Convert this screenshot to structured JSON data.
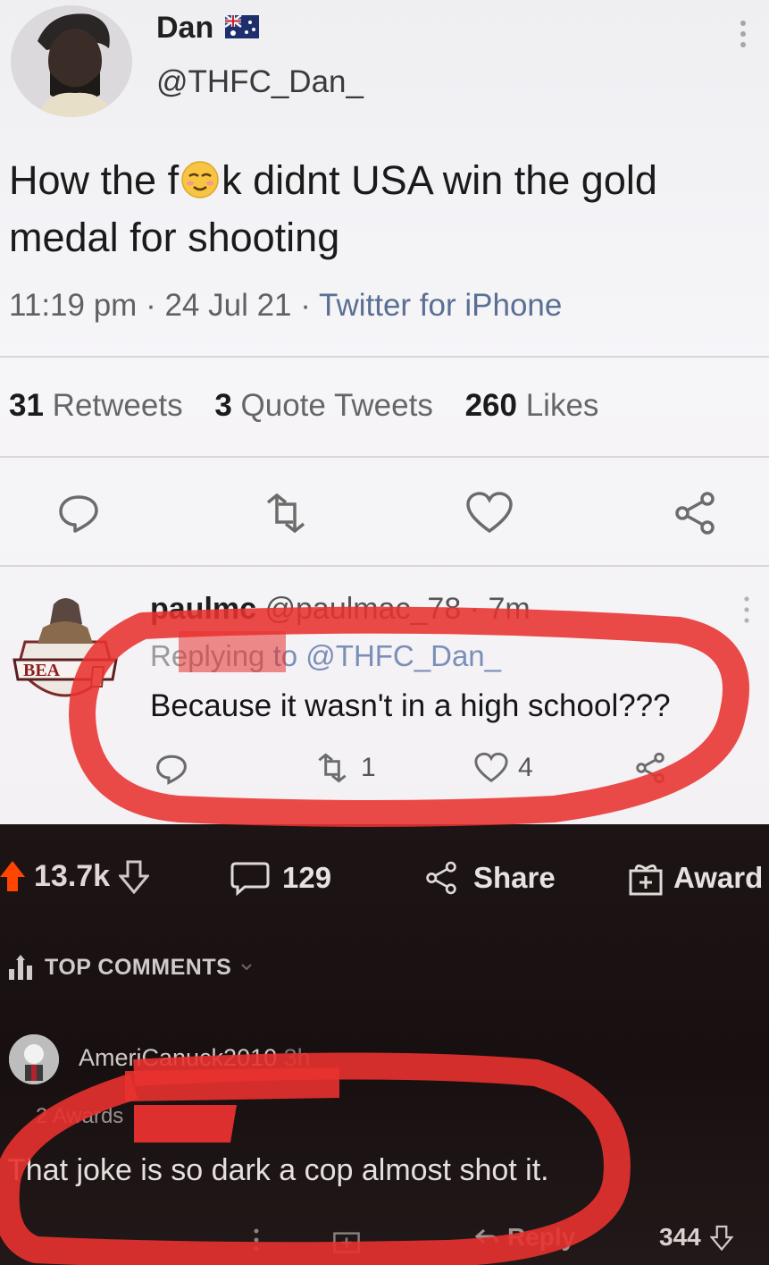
{
  "tweet": {
    "author_name": "Dan",
    "author_handle": "@THFC_Dan_",
    "text_before": "How the f",
    "text_after": "k didnt USA win the gold medal for shooting",
    "time": "11:19 pm",
    "date": "24 Jul 21",
    "source": "Twitter for iPhone",
    "retweets_count": "31",
    "retweets_label": "Retweets",
    "quotes_count": "3",
    "quotes_label": "Quote Tweets",
    "likes_count": "260",
    "likes_label": "Likes"
  },
  "reply": {
    "name": "paulmc",
    "handle_time": "@paulmac_78 · 7m",
    "replying_prefix": "Replying",
    "replying_to": "to @THFC_Dan_",
    "text": "Because it wasn't in a high school???",
    "retweet_count": "1",
    "like_count": "4"
  },
  "reddit": {
    "upvotes": "13.7k",
    "comments_count": "129",
    "share_label": "Share",
    "award_label": "Award",
    "top_comments_label": "TOP COMMENTS",
    "comment": {
      "username": "AmeriCanuck2010",
      "age": "3h",
      "awards": "2 Awards",
      "text": "That joke is so dark a cop almost shot it.",
      "reply_label": "Reply",
      "score": "344"
    }
  },
  "colors": {
    "annotation_red": "#e8322f",
    "twitter_link": "#7a8fb8",
    "reddit_upvote": "#ff4500"
  }
}
